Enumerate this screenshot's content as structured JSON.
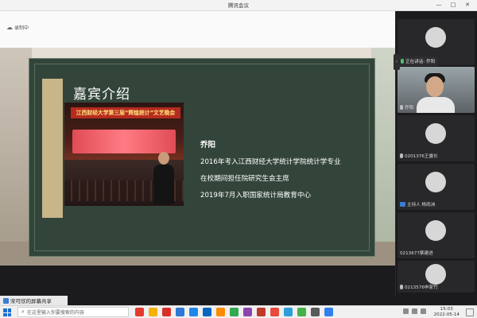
{
  "window": {
    "title": "腾讯会议",
    "controls": [
      "—",
      "□",
      "✕"
    ]
  },
  "toolbar": {
    "recording_label": "录制中",
    "recording_icon": "cloud-icon"
  },
  "slide": {
    "title": "嘉宾介绍",
    "photo_banner": "江西财经大学第三届“辉煌统计”文艺晚会",
    "guest_name": "乔阳",
    "lines": [
      "2016年考入江西财经大学统计学院统计学专业",
      "在校期间担任院研究生会主席",
      "2019年7月入职国家统计局教育中心"
    ]
  },
  "share_indicator": {
    "label": "宋可欣的屏幕共享"
  },
  "participants": {
    "speaking_label": "正在讲话: 乔阳",
    "tiles": [
      {
        "name": "",
        "type": "avatar"
      },
      {
        "name": "乔阳",
        "type": "video"
      },
      {
        "name": "0201376王露长",
        "type": "avatar"
      },
      {
        "name": "主持人 杨雨洲",
        "type": "avatar"
      },
      {
        "name": "0213677蔡建进",
        "type": "avatar"
      },
      {
        "name": "0213576申家竹",
        "type": "avatar"
      }
    ]
  },
  "taskbar": {
    "search_placeholder": "在这里输入你要搜索的内容",
    "time": "15:03",
    "date": "2022-05-14",
    "app_colors": [
      "#e23b2e",
      "#f6b100",
      "#d93025",
      "#2b7bd6",
      "#1e88e5",
      "#0a66c2",
      "#ff8a00",
      "#34a853",
      "#8e44ad",
      "#c0392b",
      "#e74c3c",
      "#2c9fdb",
      "#46b04a",
      "#5a5a5a",
      "#2f80ed"
    ]
  }
}
